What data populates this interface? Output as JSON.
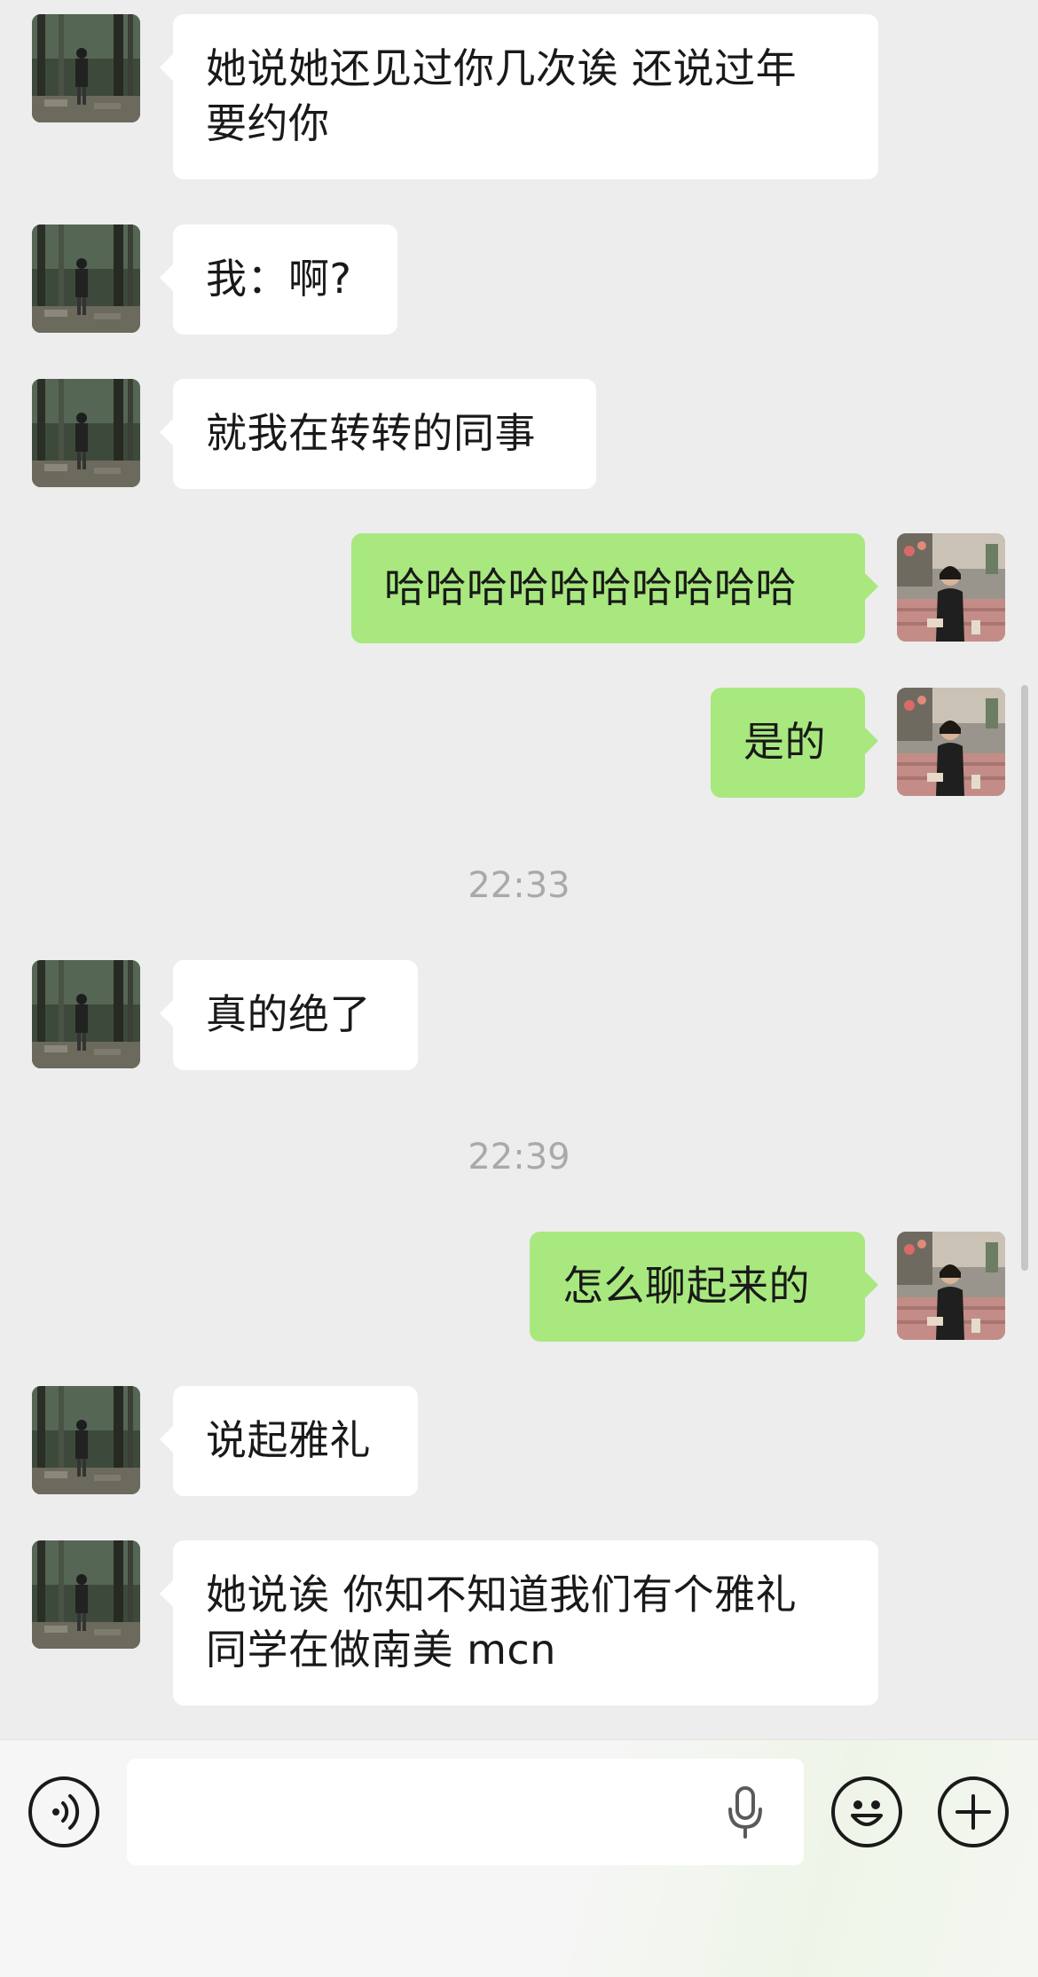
{
  "messages": [
    {
      "side": "in",
      "text": "她说她还见过你几次诶 还说过年\n要约你"
    },
    {
      "side": "in",
      "text": "我：啊?"
    },
    {
      "side": "in",
      "text": "就我在转转的同事"
    },
    {
      "side": "out",
      "text": "哈哈哈哈哈哈哈哈哈哈"
    },
    {
      "side": "out",
      "text": "是的"
    },
    {
      "side": "in",
      "text": "真的绝了"
    },
    {
      "side": "out",
      "text": "怎么聊起来的"
    },
    {
      "side": "in",
      "text": "说起雅礼"
    },
    {
      "side": "in",
      "text": "她说诶 你知不知道我们有个雅礼\n同学在做南美 mcn"
    }
  ],
  "timestamps": [
    "22:33",
    "22:39"
  ],
  "input_bar": {
    "text_value": "",
    "voice_icon": "voice-icon",
    "mic_icon": "microphone-icon",
    "emoji_icon": "emoji-icon",
    "add_icon": "plus-icon"
  },
  "colors": {
    "outgoing_bubble": "#a8e87f",
    "incoming_bubble": "#ffffff",
    "background": "#ededed"
  }
}
